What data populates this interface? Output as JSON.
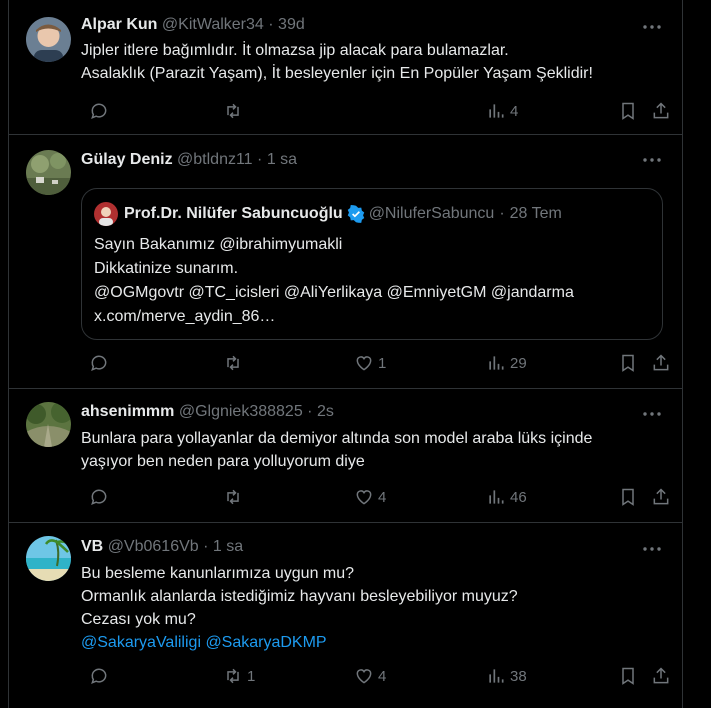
{
  "tweets": [
    {
      "name": "Alpar Kun",
      "handle": "@KitWalker34",
      "time": "39d",
      "lines": [
        "Jipler itlere bağımlıdır. İt olmazsa jip alacak para bulamazlar.",
        "Asalaklık (Parazit Yaşam), İt besleyenler için En Popüler Yaşam Şeklidir!"
      ],
      "replies": "",
      "retweets": "",
      "likes": "",
      "views": "4"
    },
    {
      "name": "Gülay Deniz",
      "handle": "@btldnz11",
      "time": "1 sa",
      "quote": {
        "name": "Prof.Dr. Nilüfer Sabuncuoğlu",
        "handle": "@NiluferSabuncu",
        "time": "28 Tem",
        "lines": [
          "Sayın Bakanımız @ibrahimyumakli",
          "Dikkatinize sunarım.",
          "@OGMgovtr @TC_icisleri @AliYerlikaya @EmniyetGM @jandarma",
          "x.com/merve_aydin_86…"
        ]
      },
      "replies": "",
      "retweets": "",
      "likes": "1",
      "views": "29"
    },
    {
      "name": "ahsenimmm",
      "handle": "@Glgniek388825",
      "time": "2s",
      "lines": [
        "Bunlara para yollayanlar da demiyor altında son model araba lüks içinde",
        "yaşıyor ben neden para yolluyorum diye"
      ],
      "replies": "",
      "retweets": "",
      "likes": "4",
      "views": "46"
    },
    {
      "name": "VB",
      "handle": "@Vb0616Vb",
      "time": "1 sa",
      "lines": [
        "Bu besleme kanunlarımıza uygun mu?",
        "Ormanlık alanlarda istediğimiz hayvanı besleyebiliyor muyuz?",
        "Cezası yok mu?"
      ],
      "mentions": "@SakaryaValiligi @SakaryaDKMP",
      "replies": "",
      "retweets": "1",
      "likes": "4",
      "views": "38"
    }
  ],
  "separator": "·",
  "colors": {
    "background": "#000000",
    "text": "#e7e9ea",
    "muted": "#71767b",
    "link": "#1d9bf0",
    "border": "#2f3336"
  },
  "icons": [
    "reply-icon",
    "retweet-icon",
    "like-icon",
    "views-icon",
    "bookmark-icon",
    "share-icon",
    "more-icon",
    "verified-badge-icon"
  ]
}
